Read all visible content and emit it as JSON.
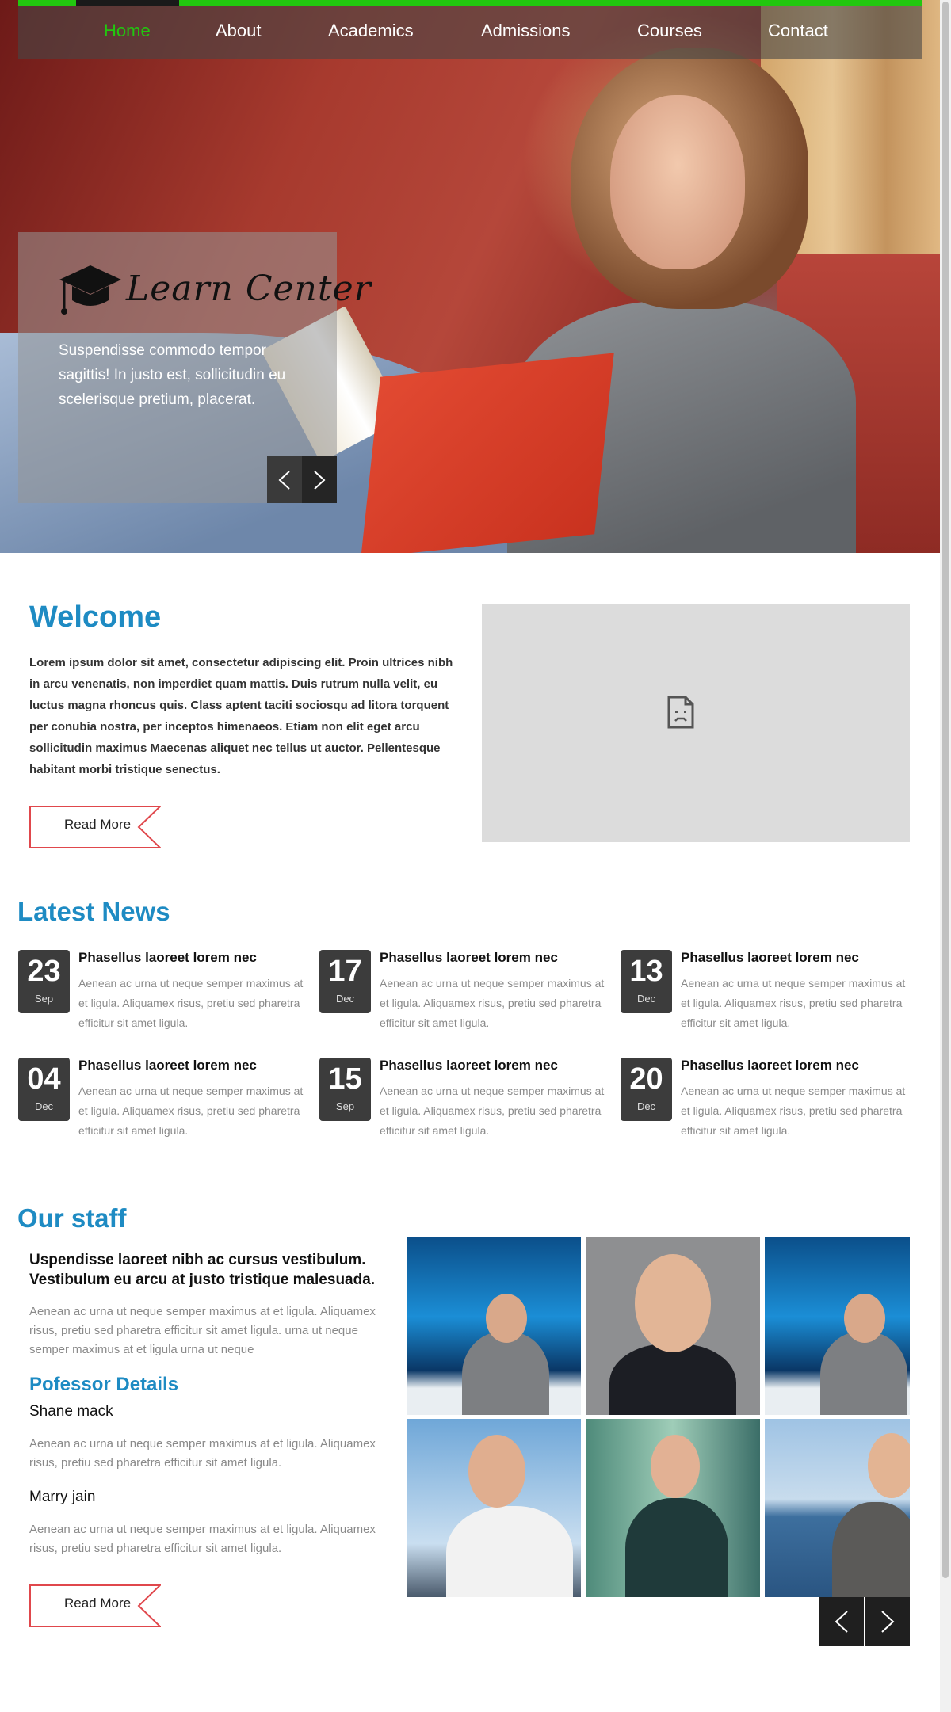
{
  "nav": {
    "items": [
      {
        "label": "Home",
        "active": true
      },
      {
        "label": "About",
        "active": false
      },
      {
        "label": "Academics",
        "active": false
      },
      {
        "label": "Admissions",
        "active": false
      },
      {
        "label": "Courses",
        "active": false
      },
      {
        "label": "Contact",
        "active": false
      }
    ],
    "accent_color": "#22c70f"
  },
  "hero": {
    "logo_text": "Learn Center",
    "logo_icon": "graduation-cap-icon",
    "caption": "Suspendisse commodo tempor sagittis! In justo est, sollicitudin eu scelerisque pretium, placerat.",
    "prev_icon": "chevron-left-icon",
    "next_icon": "chevron-right-icon"
  },
  "welcome": {
    "title": "Welcome",
    "text": "Lorem ipsum dolor sit amet, consectetur adipiscing elit. Proin ultrices nibh in arcu venenatis, non imperdiet quam mattis. Duis rutrum nulla velit, eu luctus magna rhoncus quis. Class aptent taciti sociosqu ad litora torquent per conubia nostra, per inceptos himenaeos. Etiam non elit eget arcu sollicitudin maximus Maecenas aliquet nec tellus ut auctor. Pellentesque habitant morbi tristique senectus.",
    "read_more": "Read More",
    "video_icon": "broken-page-icon"
  },
  "news": {
    "title": "Latest News",
    "items": [
      {
        "day": "23",
        "month": "Sep",
        "headline": "Phasellus laoreet lorem nec",
        "body": "Aenean ac urna ut neque semper maximus at et ligula. Aliquamex risus, pretiu sed pharetra efficitur sit amet ligula."
      },
      {
        "day": "17",
        "month": "Dec",
        "headline": "Phasellus laoreet lorem nec",
        "body": "Aenean ac urna ut neque semper maximus at et ligula. Aliquamex risus, pretiu sed pharetra efficitur sit amet ligula."
      },
      {
        "day": "13",
        "month": "Dec",
        "headline": "Phasellus laoreet lorem nec",
        "body": "Aenean ac urna ut neque semper maximus at et ligula. Aliquamex risus, pretiu sed pharetra efficitur sit amet ligula."
      },
      {
        "day": "04",
        "month": "Dec",
        "headline": "Phasellus laoreet lorem nec",
        "body": "Aenean ac urna ut neque semper maximus at et ligula. Aliquamex risus, pretiu sed pharetra efficitur sit amet ligula."
      },
      {
        "day": "15",
        "month": "Sep",
        "headline": "Phasellus laoreet lorem nec",
        "body": "Aenean ac urna ut neque semper maximus at et ligula. Aliquamex risus, pretiu sed pharetra efficitur sit amet ligula."
      },
      {
        "day": "20",
        "month": "Dec",
        "headline": "Phasellus laoreet lorem nec",
        "body": "Aenean ac urna ut neque semper maximus at et ligula. Aliquamex risus, pretiu sed pharetra efficitur sit amet ligula."
      }
    ]
  },
  "staff": {
    "title": "Our staff",
    "lead": "Uspendisse laoreet nibh ac cursus vestibulum. Vestibulum eu arcu at justo tristique malesuada.",
    "intro": "Aenean ac urna ut neque semper maximus at et ligula. Aliquamex risus, pretiu sed pharetra efficitur sit amet ligula. urna ut neque semper maximus at et ligula urna ut neque",
    "details_title": "Pofessor Details",
    "members": [
      {
        "name": "Shane mack",
        "bio": "Aenean ac urna ut neque semper maximus at et ligula. Aliquamex risus, pretiu sed pharetra efficitur sit amet ligula."
      },
      {
        "name": "Marry jain",
        "bio": "Aenean ac urna ut neque semper maximus at et ligula. Aliquamex risus, pretiu sed pharetra efficitur sit amet ligula."
      }
    ],
    "read_more": "Read More",
    "prev_icon": "chevron-left-icon",
    "next_icon": "chevron-right-icon"
  },
  "colors": {
    "heading_blue": "#1e8bc3",
    "read_more_border": "#e0474c",
    "date_badge": "#3c3c3c"
  }
}
